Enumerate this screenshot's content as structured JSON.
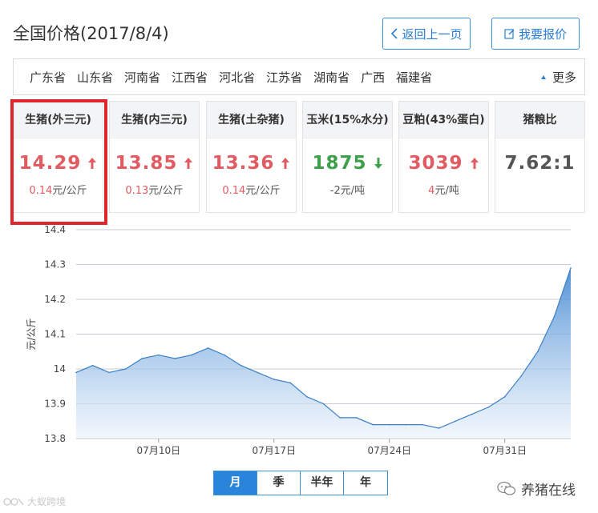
{
  "header": {
    "title": "全国价格(2017/8/4)",
    "back_label": "返回上一页",
    "quote_label": "我要报价"
  },
  "regions": {
    "items": [
      "广东省",
      "山东省",
      "河南省",
      "江西省",
      "河北省",
      "江苏省",
      "湖南省",
      "广西",
      "福建省"
    ],
    "more_label": "更多"
  },
  "cards": [
    {
      "name": "生猪(外三元)",
      "value": "14.29",
      "trend": "up",
      "change": "0.14",
      "unit": "元/公斤"
    },
    {
      "name": "生猪(内三元)",
      "value": "13.85",
      "trend": "up",
      "change": "0.13",
      "unit": "元/公斤"
    },
    {
      "name": "生猪(土杂猪)",
      "value": "13.36",
      "trend": "up",
      "change": "0.14",
      "unit": "元/公斤"
    },
    {
      "name": "玉米(15%水分)",
      "value": "1875",
      "trend": "down",
      "change": "-2",
      "unit": "元/吨"
    },
    {
      "name": "豆粕(43%蛋白)",
      "value": "3039",
      "trend": "up",
      "change": "4",
      "unit": "元/吨"
    },
    {
      "name": "猪粮比",
      "value": "7.62:1",
      "trend": "none",
      "change": "",
      "unit": ""
    }
  ],
  "colors": {
    "accent": "#2a84d9",
    "up": "#e25a62",
    "down": "#3ea04a",
    "highlight": "#e0262d"
  },
  "chart_data": {
    "type": "area",
    "ylabel": "元/公斤",
    "ylim": [
      13.8,
      14.4
    ],
    "yticks": [
      13.8,
      13.9,
      14,
      14.1,
      14.2,
      14.3,
      14.4
    ],
    "xticks": [
      "07月10日",
      "07月17日",
      "07月24日",
      "07月31日"
    ],
    "xtick_index": [
      5,
      12,
      19,
      26
    ],
    "grid": true,
    "x": [
      "07月05日",
      "07月06日",
      "07月07日",
      "07月08日",
      "07月09日",
      "07月10日",
      "07月11日",
      "07月12日",
      "07月13日",
      "07月14日",
      "07月15日",
      "07月16日",
      "07月17日",
      "07月18日",
      "07月19日",
      "07月20日",
      "07月21日",
      "07月22日",
      "07月23日",
      "07月24日",
      "07月25日",
      "07月26日",
      "07月27日",
      "07月28日",
      "07月29日",
      "07月30日",
      "07月31日",
      "08月01日",
      "08月02日",
      "08月03日",
      "08月04日"
    ],
    "series": [
      {
        "values": [
          13.99,
          14.01,
          13.99,
          14.0,
          14.03,
          14.04,
          14.03,
          14.04,
          14.06,
          14.04,
          14.01,
          13.99,
          13.97,
          13.96,
          13.92,
          13.9,
          13.86,
          13.86,
          13.84,
          13.84,
          13.84,
          13.84,
          13.83,
          13.85,
          13.87,
          13.89,
          13.92,
          13.98,
          14.05,
          14.15,
          14.29
        ]
      }
    ]
  },
  "period_tabs": {
    "items": [
      "月",
      "季",
      "半年",
      "年"
    ],
    "active": 0
  },
  "watermarks": {
    "right": "养猪在线",
    "left": "大蚁跨境"
  }
}
